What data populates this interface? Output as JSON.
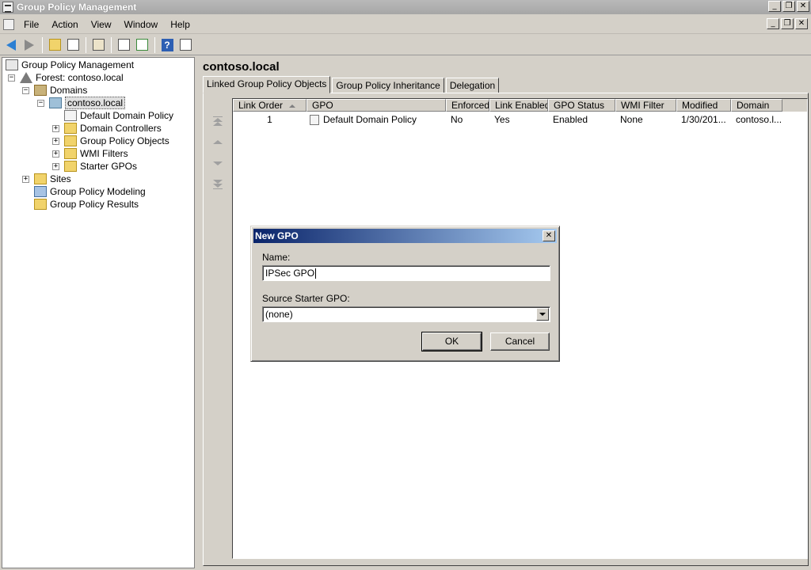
{
  "window": {
    "title": "Group Policy Management",
    "controls": [
      "_",
      "❐",
      "✕"
    ]
  },
  "menu": [
    "File",
    "Action",
    "View",
    "Window",
    "Help"
  ],
  "toolbar": {
    "buttons": [
      "back-arrow-icon",
      "forward-arrow-icon",
      "up-folder-icon",
      "show-hide-tree-icon",
      "clipboard-icon",
      "properties-icon",
      "refresh-icon",
      "help-icon",
      "export-list-icon"
    ]
  },
  "tree": {
    "root": "Group Policy Management",
    "forest": "Forest: contoso.local",
    "domains": "Domains",
    "domain": "contoso.local",
    "children": [
      "Default Domain Policy",
      "Domain Controllers",
      "Group Policy Objects",
      "WMI Filters",
      "Starter GPOs"
    ],
    "sites": "Sites",
    "modeling": "Group Policy Modeling",
    "results": "Group Policy Results"
  },
  "content": {
    "title": "contoso.local",
    "tabs": [
      "Linked Group Policy Objects",
      "Group Policy Inheritance",
      "Delegation"
    ],
    "columns": [
      "Link Order",
      "GPO",
      "Enforced",
      "Link Enabled",
      "GPO Status",
      "WMI Filter",
      "Modified",
      "Domain"
    ],
    "rows": [
      {
        "link_order": "1",
        "gpo": "Default Domain Policy",
        "enforced": "No",
        "link_enabled": "Yes",
        "gpo_status": "Enabled",
        "wmi_filter": "None",
        "modified": "1/30/201...",
        "domain": "contoso.l..."
      }
    ]
  },
  "dialog": {
    "title": "New GPO",
    "close": "✕",
    "name_label": "Name:",
    "name_value": "IPSec GPO",
    "source_label": "Source Starter GPO:",
    "source_value": "(none)",
    "ok": "OK",
    "cancel": "Cancel"
  },
  "colors": {
    "dialog_title_start": "#0a246a",
    "dialog_title_end": "#a6caf0",
    "window_title": "#a6a6a6"
  }
}
